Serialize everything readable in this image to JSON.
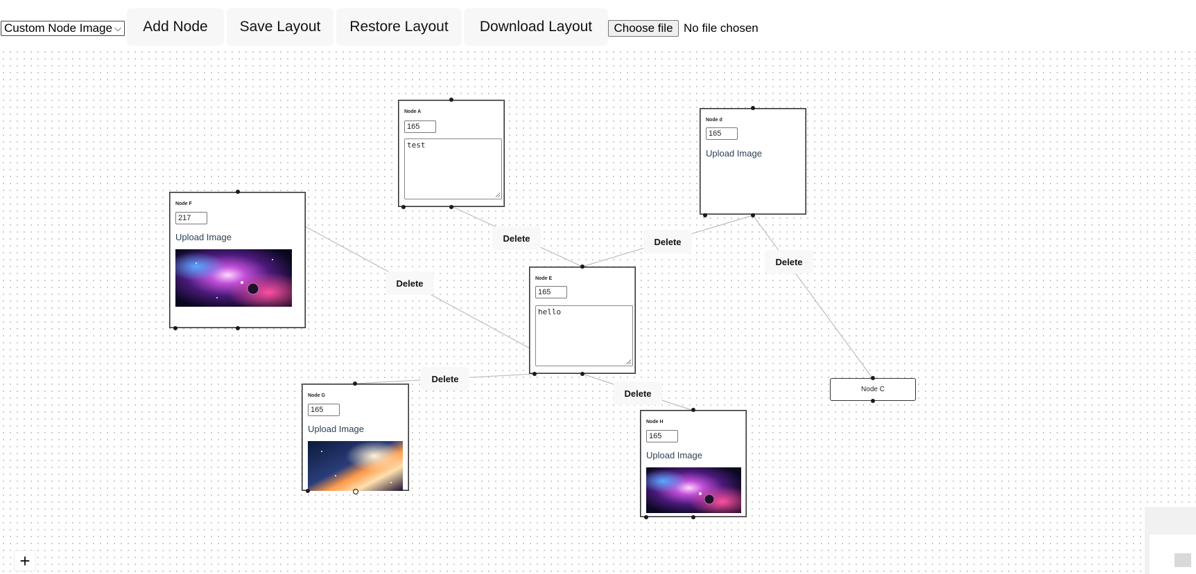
{
  "toolbar": {
    "node_type_select": "Custom Node Image",
    "add_node": "Add Node",
    "save_layout": "Save Layout",
    "restore_layout": "Restore Layout",
    "download_layout": "Download Layout",
    "choose_file": "Choose file",
    "file_status": "No file chosen"
  },
  "nodes": {
    "a": {
      "title": "Node A",
      "value": "165",
      "text": "test"
    },
    "d": {
      "title": "Node d",
      "value": "165",
      "upload": "Upload Image"
    },
    "f": {
      "title": "Node F",
      "value": "217",
      "upload": "Upload Image",
      "image": "nebula-purple"
    },
    "e": {
      "title": "Node E",
      "value": "165",
      "text": "hello"
    },
    "g": {
      "title": "Node G",
      "value": "165",
      "upload": "Upload Image",
      "image": "galaxy-orange"
    },
    "h": {
      "title": "Node H",
      "value": "165",
      "upload": "Upload Image",
      "image": "nebula-purple"
    },
    "c": {
      "title": "Node C"
    }
  },
  "edges": {
    "delete_label": "Delete"
  },
  "controls": {
    "zoom_in": "+"
  },
  "colors": {
    "canvas_dot": "#c9c9c9",
    "edge": "#bdbdbd",
    "node_border": "#333333",
    "handle": "#1a1a1a"
  }
}
